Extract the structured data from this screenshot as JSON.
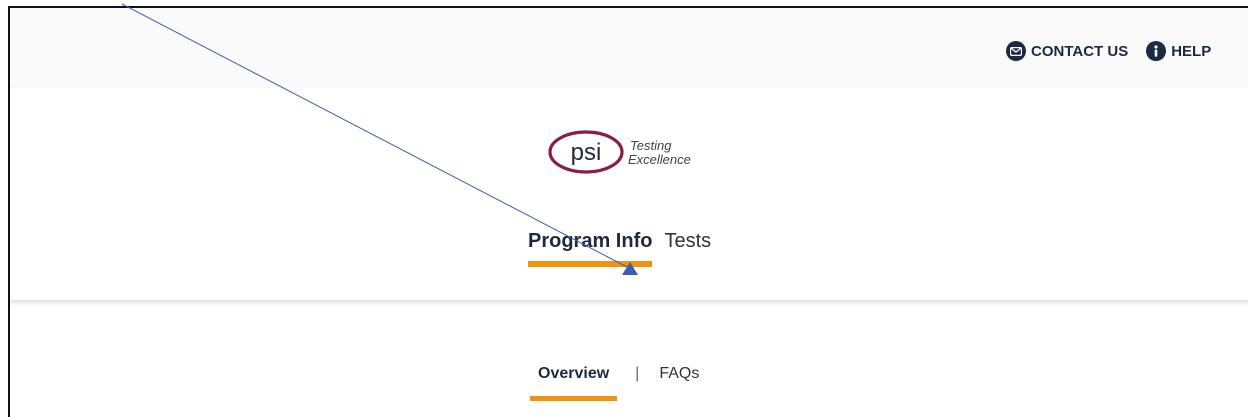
{
  "topbar": {
    "contact_label": "CONTACT US",
    "help_label": "HELP"
  },
  "logo": {
    "brand": "psi",
    "tagline_line1": "Testing",
    "tagline_line2": "Excellence"
  },
  "main_nav": {
    "tabs": [
      {
        "label": "Program Info",
        "active": true
      },
      {
        "label": "Tests",
        "active": false
      }
    ]
  },
  "sub_nav": {
    "tabs": [
      {
        "label": "Overview",
        "active": true
      },
      {
        "label": "FAQs",
        "active": false
      }
    ],
    "separator": "|"
  },
  "colors": {
    "accent": "#f2930f",
    "brand_maroon": "#8b1e3f",
    "navy": "#1b2a45",
    "annotation": "#3a5fb0"
  },
  "icons": {
    "contact": "envelope-icon",
    "help": "info-icon"
  }
}
